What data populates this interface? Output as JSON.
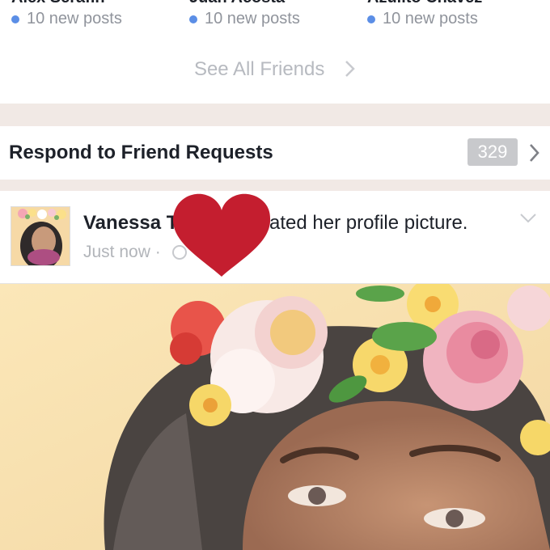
{
  "friends": [
    {
      "name": "Alex Serafin",
      "status": "10 new posts"
    },
    {
      "name": "Juan Acosta",
      "status": "10 new posts"
    },
    {
      "name": "Azulito Chavez",
      "status": "10 new posts"
    }
  ],
  "see_all_label": "See All Friends",
  "requests": {
    "label": "Respond to Friend Requests",
    "count": "329"
  },
  "post": {
    "author": "Vanessa T",
    "action": "ated her profile picture.",
    "timestamp": "Just now ·"
  },
  "icons": {
    "status_dot": "online-dot-icon",
    "chevron": "chevron-right-icon",
    "menu": "chevron-down-icon",
    "privacy": "globe-icon",
    "sticker": "heart-icon"
  },
  "colors": {
    "separator": "#f1e9e5",
    "status_dot": "#5b8ee6",
    "heart": "#c41e2f",
    "badge": "#c8c9cc"
  }
}
